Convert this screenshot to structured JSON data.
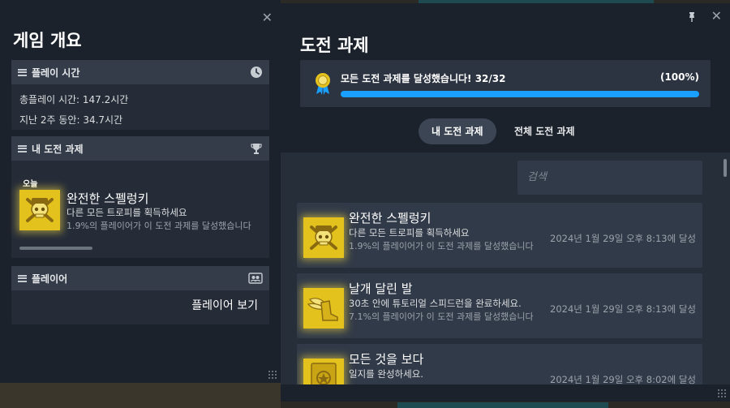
{
  "game_overview": {
    "title": "게임 개요",
    "close_icon": "close-icon",
    "playtime": {
      "header": "플레이 시간",
      "icon": "clock-icon",
      "total": "총플레이 시간: 147.2시간",
      "recent": "지난 2주 동안: 34.7시간"
    },
    "my_achievements": {
      "header": "내 도전 과제",
      "icon": "trophy-icon",
      "day_label": "오늘",
      "item": {
        "title": "완전한 스펠렁키",
        "desc": "다른 모든 트로피를 획득하세요",
        "pct": "1.9%의 플레이어가 이 도전 과제를 달성했습니다"
      }
    },
    "players": {
      "header": "플레이어",
      "icon": "players-icon",
      "view_button": "플레이어 보기"
    }
  },
  "achievements": {
    "title": "도전 과제",
    "pin_icon": "pin-icon",
    "close_icon": "close-icon",
    "progress": {
      "text": "모든 도전 과제를 달성했습니다! 32/32",
      "percent_label": "(100%)",
      "fraction": 1.0,
      "bar_color": "#1a9fff"
    },
    "tabs": [
      {
        "label": "내 도전 과제",
        "active": true
      },
      {
        "label": "전체 도전 과제",
        "active": false
      }
    ],
    "search": {
      "placeholder": "검색"
    },
    "list": [
      {
        "icon": "skull-crossbones-icon",
        "title": "완전한 스펠렁키",
        "desc": "다른 모든 트로피를 획득하세요",
        "pct": "1.9%의 플레이어가 이 도전 과제를 달성했습니다",
        "date": "2024년 1월 29일 오후 8:13에 달성"
      },
      {
        "icon": "winged-boot-icon",
        "title": "날개 달린 발",
        "desc": "30초 안에 튜토리얼 스피드런을 완료하세요.",
        "pct": "7.1%의 플레이어가 이 도전 과제를 달성했습니다",
        "date": "2024년 1월 29일 오후 8:13에 달성"
      },
      {
        "icon": "journal-icon",
        "title": "모든 것을 보다",
        "desc": "일지를 완성하세요.",
        "pct": "",
        "date": "2024년 1월 29일 오후 8:02에 달성"
      }
    ]
  },
  "colors": {
    "panel_bg": "#1c222c",
    "card_bg": "#313a48",
    "accent": "#1a9fff",
    "achievement_gold": "#e4c21e"
  }
}
